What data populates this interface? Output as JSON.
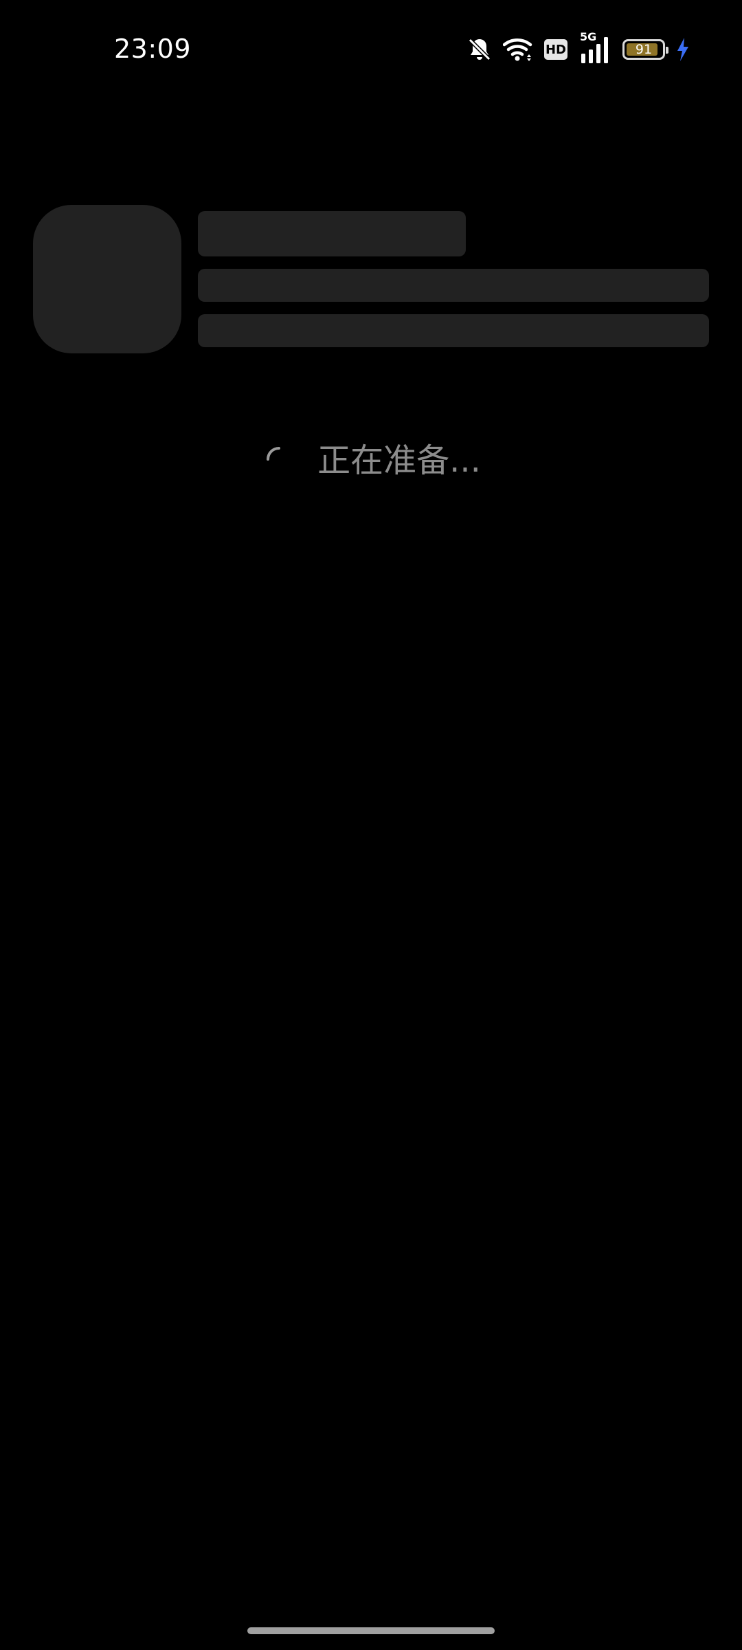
{
  "status_bar": {
    "time": "23:09",
    "network": "5G",
    "hd_label": "HD",
    "battery_level": "91",
    "battery_percent": 91,
    "icons": [
      "mute-icon",
      "wifi-icon",
      "hd-icon",
      "signal-icon",
      "battery-icon",
      "charging-icon"
    ],
    "charging_color": "#3b6ef5",
    "battery_fill_color": "#8f7427"
  },
  "loading": {
    "text": "正在准备..."
  }
}
